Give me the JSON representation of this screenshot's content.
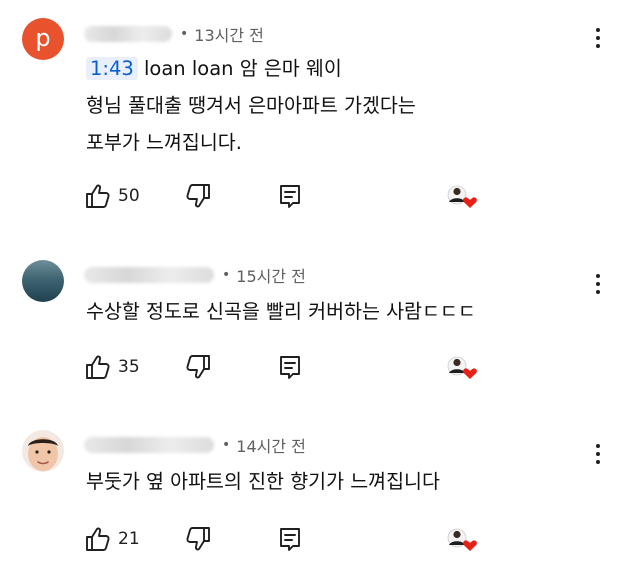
{
  "comments": [
    {
      "avatar_letter": "p",
      "time": "13시간 전",
      "timestamp": "1:43",
      "lines": [
        "loan loan 암 은마 웨이",
        "형님 풀대출 땡겨서 은마아파트 가겠다는",
        "포부가 느껴집니다."
      ],
      "likes": "50"
    },
    {
      "time": "15시간 전",
      "lines": [
        "수상할 정도로 신곡을 빨리 커버하는 사람ㄷㄷㄷ"
      ],
      "likes": "35"
    },
    {
      "time": "14시간 전",
      "lines": [
        "부둣가 옆 아파트의 진한 향기가 느껴집니다"
      ],
      "likes": "21"
    }
  ],
  "icons": {
    "like": "thumbs-up-icon",
    "dislike": "thumbs-down-icon",
    "reply": "reply-icon",
    "more": "more-vert-icon",
    "creator_heart": "creator-heart-icon"
  },
  "colors": {
    "timestamp_link": "#065fd4",
    "heart": "#e62117",
    "avatar_p": "#e8522d"
  }
}
